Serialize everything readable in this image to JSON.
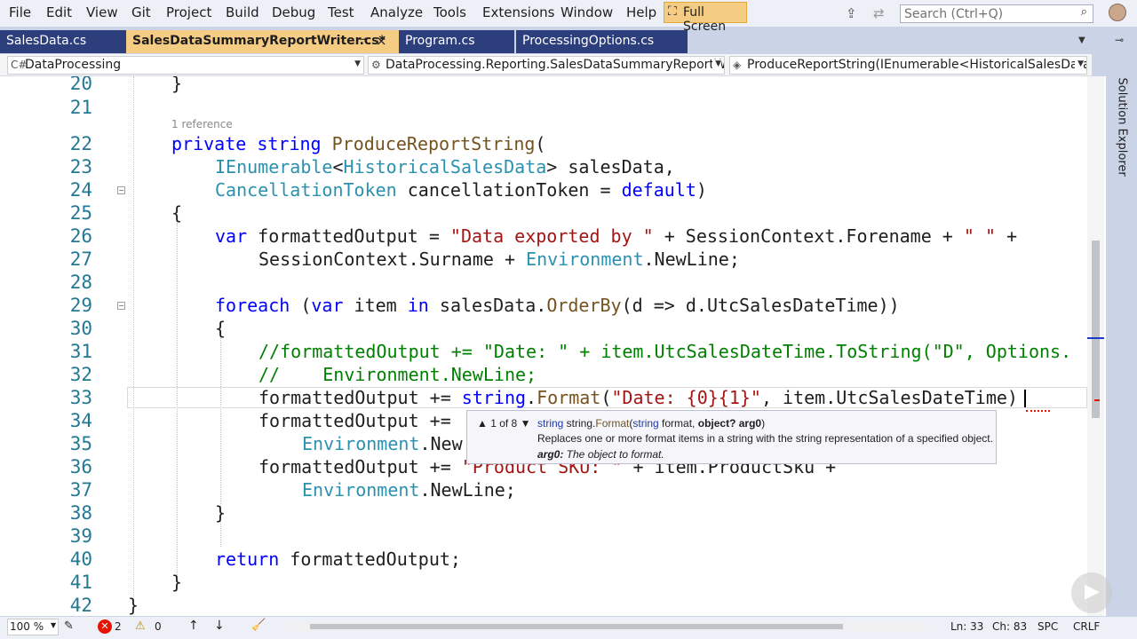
{
  "menu": [
    "File",
    "Edit",
    "View",
    "Git",
    "Project",
    "Build",
    "Debug",
    "Test",
    "Analyze",
    "Tools",
    "Extensions",
    "Window",
    "Help"
  ],
  "fullscreen_label": "Full Screen",
  "search": {
    "placeholder": "Search (Ctrl+Q)"
  },
  "tabs": [
    {
      "label": "SalesData.cs",
      "active": false
    },
    {
      "label": "SalesDataSummaryReportWriter.cs*",
      "active": true
    },
    {
      "label": "Program.cs",
      "active": false
    },
    {
      "label": "ProcessingOptions.cs",
      "active": false
    }
  ],
  "nav": {
    "project": "DataProcessing",
    "class": "DataProcessing.Reporting.SalesDataSummaryReportWriter",
    "member": "ProduceReportString(IEnumerable<HistoricalSalesData> salesData, CancellationToken cancellationToken)"
  },
  "reference_lens": "1 reference",
  "line_numbers": [
    "20",
    "21",
    "22",
    "23",
    "24",
    "25",
    "26",
    "27",
    "28",
    "29",
    "30",
    "31",
    "32",
    "33",
    "34",
    "35",
    "36",
    "37",
    "38",
    "39",
    "40",
    "41",
    "42"
  ],
  "code": {
    "l20": "}",
    "l22_kw1": "private",
    "l22_kw2": "string",
    "l22_method": "ProduceReportString",
    "l22_paren": "(",
    "l23_type1": "IEnumerable",
    "l23_lt": "<",
    "l23_type2": "HistoricalSalesData",
    "l23_rest": "> salesData,",
    "l24_type": "CancellationToken",
    "l24_mid": " cancellationToken = ",
    "l24_kw": "default",
    "l24_end": ")",
    "l25": "{",
    "l26_kw": "var",
    "l26_a": " formattedOutput = ",
    "l26_str1": "\"Data exported by \"",
    "l26_b": " + SessionContext.Forename + ",
    "l26_str2": "\" \"",
    "l26_c": " +",
    "l27_a": "SessionContext.Surname + ",
    "l27_type": "Environment",
    "l27_b": ".NewLine;",
    "l29_kw1": "foreach",
    "l29_a": " (",
    "l29_kw2": "var",
    "l29_b": " item ",
    "l29_kw3": "in",
    "l29_c": " salesData.",
    "l29_method": "OrderBy",
    "l29_d": "(d => d.UtcSalesDateTime))",
    "l30": "{",
    "l31": "//formattedOutput += \"Date: \" + item.UtcSalesDateTime.ToString(\"D\", Options.",
    "l32": "//    Environment.NewLine;",
    "l33_a": "formattedOutput += ",
    "l33_kw": "string",
    "l33_dot": ".",
    "l33_method": "Format",
    "l33_paren": "(",
    "l33_str": "\"Date: {0}{1}\"",
    "l33_b": ", item.UtcSalesDateTime)",
    "l34_a": "formattedOutput += ",
    "l35_a": "Environment",
    "l35_b": ".New",
    "l36_a": "formattedOutput += ",
    "l36_str": "\"Product SKU: \"",
    "l36_b": " + item.ProductSku +",
    "l37_type": "Environment",
    "l37_b": ".NewLine;",
    "l38": "}",
    "l40_kw": "return",
    "l40_b": " formattedOutput;",
    "l41": "}",
    "l42": "}"
  },
  "tooltip": {
    "pager": "▲ 1 of 8 ▼",
    "sig_ret": "string",
    "sig_cls": " string.",
    "sig_method": "Format",
    "sig_open": "(",
    "sig_p1type": "string",
    "sig_p1": " format, ",
    "sig_p2": "object? arg0",
    "sig_close": ")",
    "description": "Replaces one or more format items in a string with the string representation of a specified object.",
    "param_name": "arg0:",
    "param_desc": " The object to format."
  },
  "side_panel": {
    "label": "Solution Explorer"
  },
  "status": {
    "zoom": "100 %",
    "errors": "2",
    "warnings": "0",
    "position": "Ln: 33",
    "column": "Ch: 83",
    "indent": "SPC",
    "line_ending": "CRLF"
  }
}
